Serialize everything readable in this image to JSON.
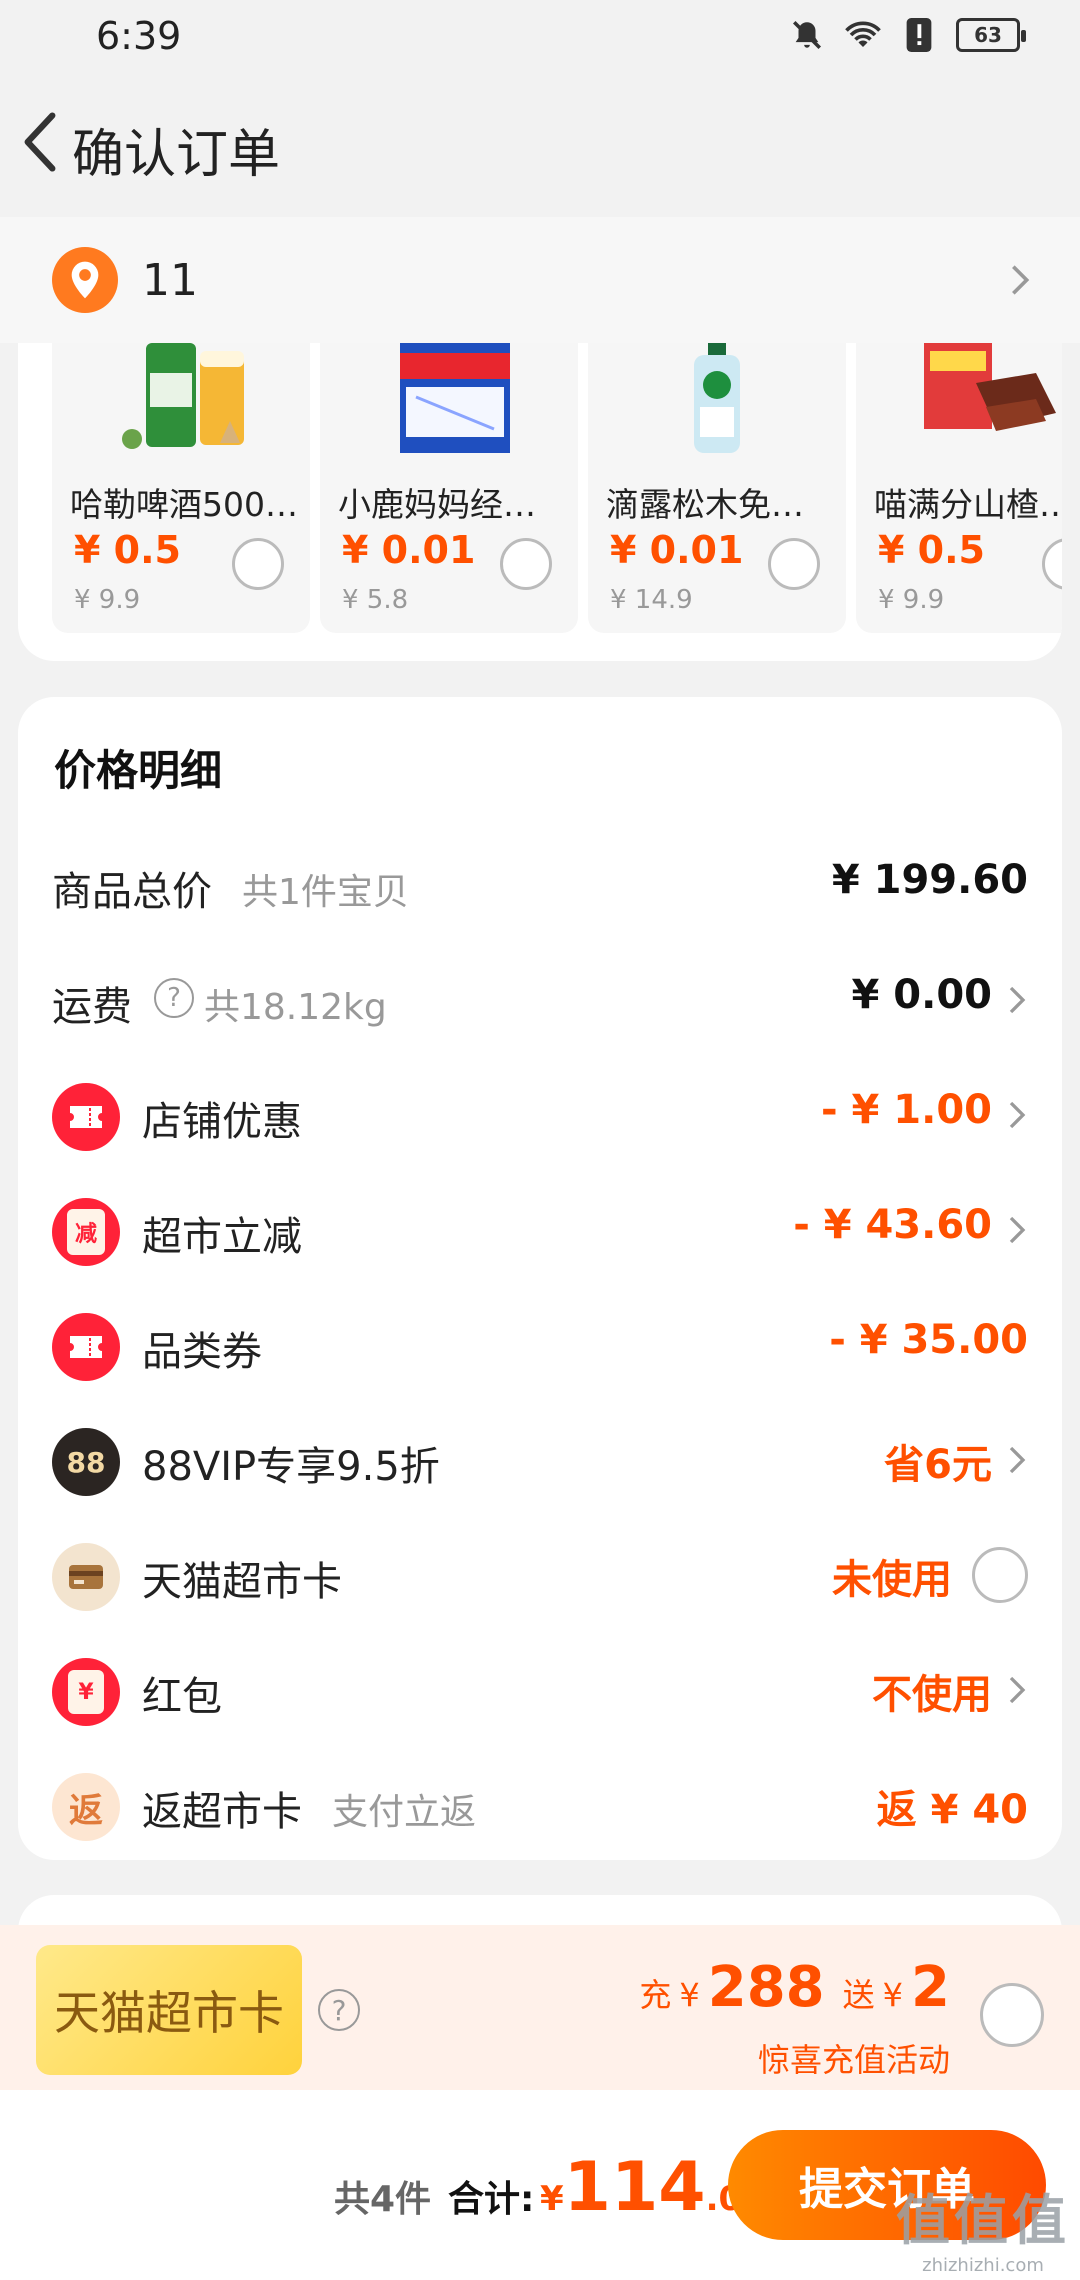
{
  "status_bar": {
    "time": "6:39",
    "battery": "63"
  },
  "header": {
    "title": "确认订单"
  },
  "address": {
    "text": "11"
  },
  "products": [
    {
      "name": "哈勒啤酒500…",
      "price": "¥ 0.5",
      "original_price": "¥ 9.9"
    },
    {
      "name": "小鹿妈妈经…",
      "price": "¥ 0.01",
      "original_price": "¥ 5.8"
    },
    {
      "name": "滴露松木免…",
      "price": "¥ 0.01",
      "original_price": "¥ 14.9"
    },
    {
      "name": "喵满分山楂…",
      "price": "¥ 0.5",
      "original_price": "¥ 9.9"
    }
  ],
  "price_detail": {
    "title": "价格明细",
    "rows": [
      {
        "label": "商品总价",
        "sub": "共1件宝贝",
        "value": "¥ 199.60"
      },
      {
        "label": "运费",
        "sub": "共18.12kg",
        "value": "¥ 0.00"
      },
      {
        "label": "店铺优惠",
        "value": "- ¥ 1.00"
      },
      {
        "label": "超市立减",
        "icon_text": "减",
        "value": "- ¥ 43.60"
      },
      {
        "label": "品类券",
        "value": "- ¥ 35.00"
      },
      {
        "label": "88VIP专享9.5折",
        "icon_text": "88",
        "value": "省6元"
      },
      {
        "label": "天猫超市卡",
        "value": "未使用"
      },
      {
        "label": "红包",
        "icon_text": "¥",
        "value": "不使用"
      },
      {
        "label": "返超市卡",
        "sub": "支付立返",
        "icon_text": "返",
        "value": "返 ¥ 40"
      }
    ]
  },
  "promo": {
    "card_label": "天猫超市卡",
    "recharge_word": "充",
    "currency": "¥",
    "recharge_amount": "288",
    "gift_word": "送",
    "gift_amount": "2",
    "subtitle": "惊喜充值活动"
  },
  "bottom": {
    "count": "共4件",
    "total_label": "合计:",
    "currency": "¥",
    "total_int": "114",
    "total_dec": ".00",
    "submit": "提交订单"
  },
  "watermark": {
    "big": "值值值",
    "small": "zhizhizhi.com"
  },
  "colors": {
    "accent": "#ff5000",
    "location": "#ff7a1f",
    "coupon_red": "#ff2238",
    "vip_dark": "#2b2522",
    "card_gold": "#ffd23c"
  }
}
